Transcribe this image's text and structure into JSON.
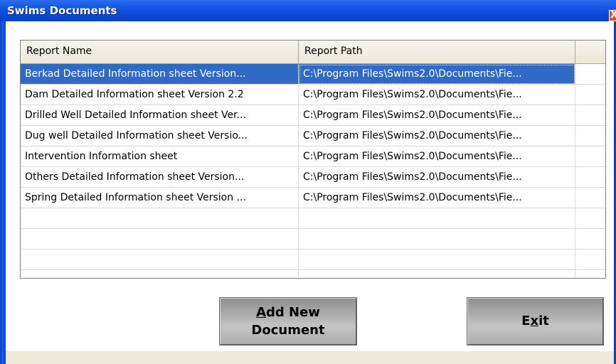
{
  "window": {
    "title": "Swims Documents",
    "close_label": "X"
  },
  "table": {
    "columns": [
      "Report Name",
      "Report Path"
    ],
    "rows": [
      [
        "Berkad Detailed Information sheet Version...",
        "C:\\Program Files\\Swims2.0\\Documents\\Fie..."
      ],
      [
        "Dam Detailed Information sheet Version 2.2",
        "C:\\Program Files\\Swims2.0\\Documents\\Fie..."
      ],
      [
        "Drilled Well Detailed Information sheet Ver...",
        "C:\\Program Files\\Swims2.0\\Documents\\Fie..."
      ],
      [
        "Dug well Detailed Information sheet Versio...",
        "C:\\Program Files\\Swims2.0\\Documents\\Fie..."
      ],
      [
        "Intervention Information sheet",
        "C:\\Program Files\\Swims2.0\\Documents\\Fie..."
      ],
      [
        "Others Detailed Information sheet Version...",
        "C:\\Program Files\\Swims2.0\\Documents\\Fie..."
      ],
      [
        "Spring Detailed Information sheet Version ...",
        "C:\\Program Files\\Swims2.0\\Documents\\Fie..."
      ]
    ],
    "selected_row": 0
  },
  "buttons": {
    "add_new": {
      "line1_mnemonic": "A",
      "line1_rest": "dd New",
      "line2": "Document"
    },
    "exit": {
      "before": "E",
      "mnemonic": "x",
      "after": "it"
    }
  },
  "colors": {
    "titlebar": "#0a48d6",
    "selection": "#316ac5",
    "button": "#a7a7a7"
  }
}
